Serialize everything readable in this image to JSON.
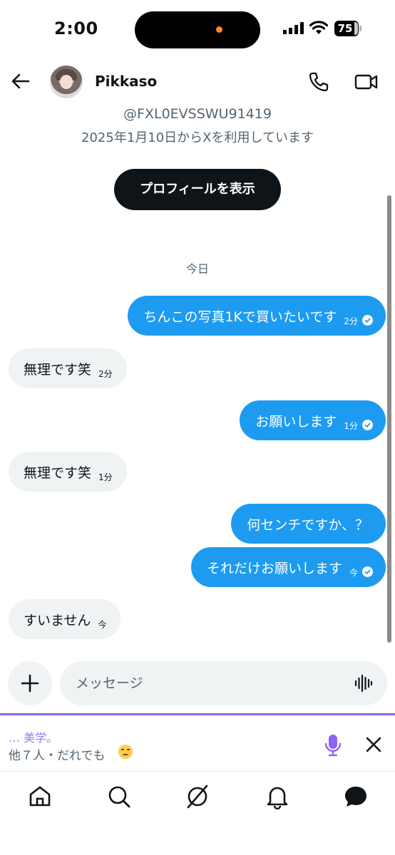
{
  "status_bar": {
    "time": "2:00",
    "battery": "75"
  },
  "header": {
    "contact_name": "Pikkaso",
    "icons": [
      "back-arrow-icon",
      "phone-icon",
      "video-camera-icon"
    ]
  },
  "profile": {
    "handle": "@FXL0EVSSWU91419",
    "joined": "2025年1月10日からXを利用しています",
    "view_profile_label": "プロフィールを表示"
  },
  "conversation": {
    "date_divider": "今日",
    "messages": [
      {
        "direction": "outgoing",
        "text": "ちんこの写真1Kで買いたいです",
        "time": "2分",
        "read": true
      },
      {
        "direction": "incoming",
        "text": "無理です笑",
        "time": "2分"
      },
      {
        "direction": "outgoing",
        "text": "お願いします",
        "time": "1分",
        "read": true
      },
      {
        "direction": "incoming",
        "text": "無理です笑",
        "time": "1分"
      },
      {
        "direction": "outgoing",
        "text": "何センチですか、？",
        "time": ""
      },
      {
        "direction": "outgoing",
        "text": "それだけお願いします",
        "time": "今",
        "read": true
      },
      {
        "direction": "incoming",
        "text": "すいません",
        "time": "今"
      }
    ]
  },
  "composer": {
    "placeholder": "メッセージ"
  },
  "group_banner": {
    "title": "… 美学。",
    "subtitle": "他７人・だれでも"
  },
  "colors": {
    "accent": "#1d9bf0",
    "incoming_bubble": "#eff3f4",
    "banner_accent": "#8c63f2",
    "text_secondary": "#536471"
  },
  "bottom_nav": [
    "home-icon",
    "search-icon",
    "grok-icon",
    "notifications-icon",
    "messages-icon"
  ]
}
